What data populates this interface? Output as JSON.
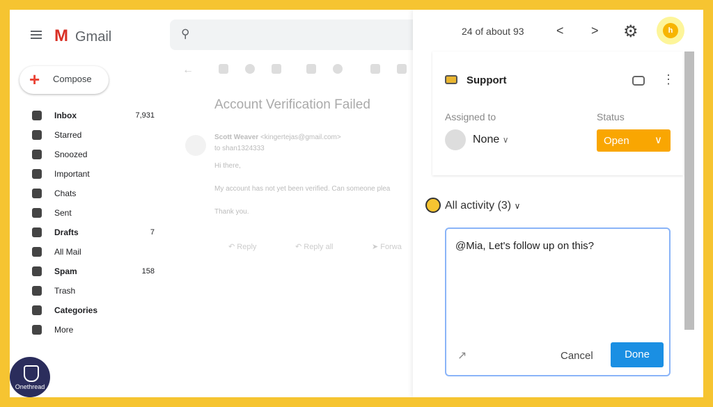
{
  "gmail": {
    "logo": "Gmail",
    "compose": "Compose",
    "nav": [
      {
        "label": "Inbox",
        "count": "7,931",
        "bold": true,
        "icon": "inbox-icon"
      },
      {
        "label": "Starred",
        "count": "",
        "icon": "star-icon"
      },
      {
        "label": "Snoozed",
        "count": "",
        "icon": "clock-icon"
      },
      {
        "label": "Important",
        "count": "",
        "icon": "important-icon"
      },
      {
        "label": "Chats",
        "count": "",
        "icon": "chat-icon"
      },
      {
        "label": "Sent",
        "count": "",
        "icon": "send-icon"
      },
      {
        "label": "Drafts",
        "count": "7",
        "bold": true,
        "icon": "draft-icon"
      },
      {
        "label": "All Mail",
        "count": "",
        "icon": "mail-icon"
      },
      {
        "label": "Spam",
        "count": "158",
        "bold": true,
        "icon": "spam-icon"
      },
      {
        "label": "Trash",
        "count": "",
        "icon": "trash-icon"
      },
      {
        "label": "Categories",
        "count": "",
        "bold": true,
        "icon": "label-icon"
      },
      {
        "label": "More",
        "count": "",
        "icon": "chevron-down-icon"
      }
    ],
    "email": {
      "subject": "Account Verification Failed",
      "sender": "Scott Weaver",
      "sender_email": "<kingertejas@gmail.com>",
      "to": "to shan1324333",
      "greeting": "Hi there,",
      "body": "My account has not yet been verified. Can someone plea",
      "closing": "Thank you.",
      "reply": "Reply",
      "reply_all": "Reply all",
      "forward": "Forwa"
    }
  },
  "header": {
    "pagination": "24 of about 93",
    "prev": "<",
    "next": ">"
  },
  "panel": {
    "inbox": "Support",
    "assigned_label": "Assigned to",
    "assigned_value": "None",
    "status_label": "Status",
    "status_value": "Open",
    "status_color": "#f9a602",
    "activity": "All activity (3)",
    "comment": "@Mia, Let's follow up on this?",
    "cancel": "Cancel",
    "done": "Done",
    "done_color": "#1a8fe3"
  },
  "watermark": "Onethread"
}
